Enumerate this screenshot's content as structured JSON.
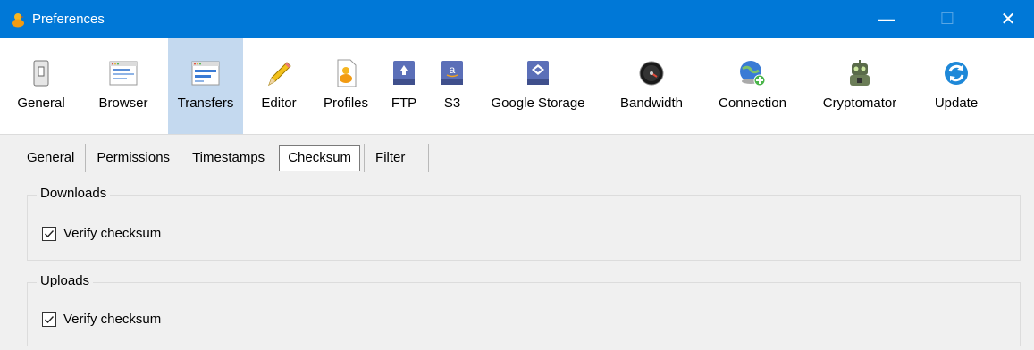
{
  "window": {
    "title": "Preferences",
    "controls": {
      "minimize": "—",
      "maximize": "☐",
      "close": "✕"
    },
    "accent": "#0078d7"
  },
  "toolbar": {
    "items": [
      {
        "label": "General",
        "icon": "switch-icon"
      },
      {
        "label": "Browser",
        "icon": "browser-window-icon"
      },
      {
        "label": "Transfers",
        "icon": "transfers-window-icon",
        "active": true
      },
      {
        "label": "Editor",
        "icon": "pencil-icon"
      },
      {
        "label": "Profiles",
        "icon": "duck-document-icon"
      },
      {
        "label": "FTP",
        "icon": "ftp-drive-icon"
      },
      {
        "label": "S3",
        "icon": "s3-drive-icon"
      },
      {
        "label": "Google Storage",
        "icon": "google-storage-icon"
      },
      {
        "label": "Bandwidth",
        "icon": "speedometer-icon"
      },
      {
        "label": "Connection",
        "icon": "globe-plus-icon"
      },
      {
        "label": "Cryptomator",
        "icon": "robot-icon"
      },
      {
        "label": "Update",
        "icon": "refresh-icon"
      }
    ]
  },
  "tabs": [
    {
      "label": "General"
    },
    {
      "label": "Permissions"
    },
    {
      "label": "Timestamps"
    },
    {
      "label": "Checksum",
      "active": true
    },
    {
      "label": "Filter"
    }
  ],
  "downloads": {
    "title": "Downloads",
    "checkbox_label": "Verify checksum",
    "checked": true
  },
  "uploads": {
    "title": "Uploads",
    "checkbox_label": "Verify checksum",
    "checked": true
  }
}
